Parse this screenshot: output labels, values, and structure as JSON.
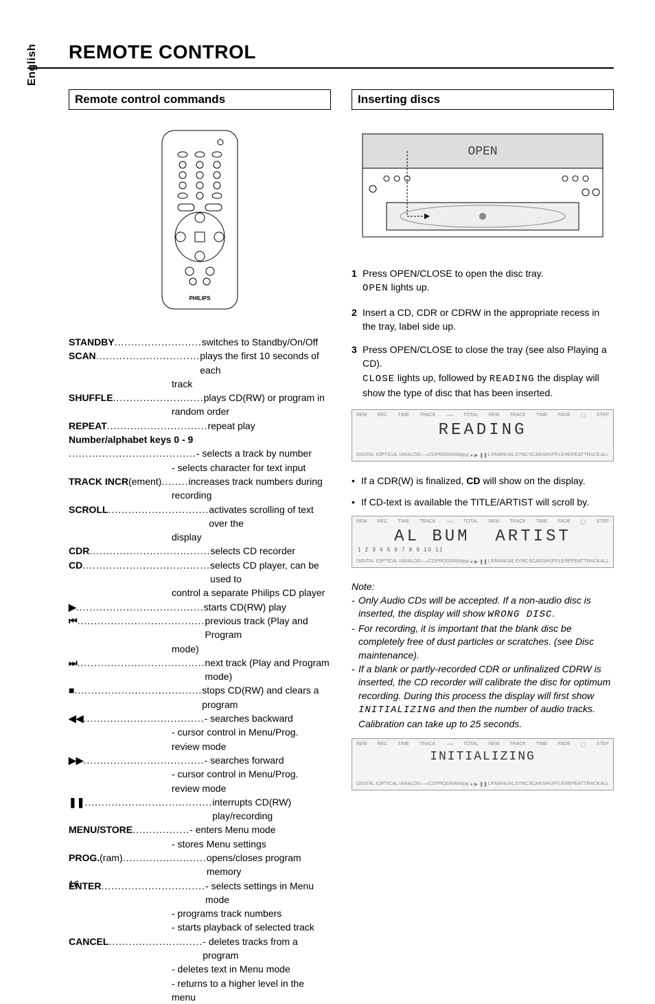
{
  "title": "REMOTE CONTROL",
  "language_tab": "English",
  "page_number": "16",
  "left": {
    "section": "Remote control commands",
    "commands": [
      {
        "term": "STANDBY",
        "dots": "..........................",
        "desc": "switches to Standby/On/Off"
      },
      {
        "term": "SCAN",
        "dots": "...............................",
        "desc": "plays the first 10 seconds of each"
      },
      {
        "cont": "track"
      },
      {
        "term": "SHUFFLE",
        "dots": "...........................",
        "desc": "plays CD(RW) or program in"
      },
      {
        "cont": "random order"
      },
      {
        "term": "REPEAT",
        "dots": "..............................",
        "desc": "repeat play"
      },
      {
        "term": "Number/alphabet keys 0 - 9"
      },
      {
        "dots": "......................................",
        "desc": "- selects a track by number"
      },
      {
        "cont": "- selects character for text input"
      },
      {
        "term": "TRACK INCR",
        "plain": "(ement)",
        "dots": " ........",
        "desc": "increases track numbers during"
      },
      {
        "cont": "recording"
      },
      {
        "term": "SCROLL",
        "dots": "..............................",
        "desc": "activates scrolling of text over the"
      },
      {
        "cont": "display"
      },
      {
        "term": "CDR",
        "dots": "....................................",
        "desc": "selects CD recorder"
      },
      {
        "term": "CD",
        "dots": "......................................",
        "desc": "selects CD player, can be used to"
      },
      {
        "cont": "control a separate Philips CD player"
      },
      {
        "sym": "▶",
        "dots": "......................................",
        "desc": "starts CD(RW) play"
      },
      {
        "sym": "⏮",
        "dots": "......................................",
        "desc": "previous track (Play and Program"
      },
      {
        "cont": "mode)"
      },
      {
        "sym": "⏭",
        "dots": "......................................",
        "desc": "next track (Play and Program mode)"
      },
      {
        "sym": "■",
        "dots": "......................................",
        "desc": "stops CD(RW) and clears a program"
      },
      {
        "sym": "◀◀",
        "dots": "....................................",
        "desc": "- searches backward"
      },
      {
        "cont": "- cursor control in Menu/Prog."
      },
      {
        "cont": "  review mode"
      },
      {
        "sym": "▶▶",
        "dots": "....................................",
        "desc": "- searches forward"
      },
      {
        "cont": "- cursor control in Menu/Prog."
      },
      {
        "cont": "  review mode"
      },
      {
        "sym": "❚❚",
        "dots": "......................................",
        "desc": "interrupts CD(RW) play/recording"
      },
      {
        "term": "MENU/STORE",
        "dots": " .................",
        "desc": "- enters Menu mode"
      },
      {
        "cont": "- stores Menu settings"
      },
      {
        "term": "PROG.",
        "plain": "(ram)",
        "dots": " .........................",
        "desc": "opens/closes program memory"
      },
      {
        "term": "ENTER",
        "dots": "...............................",
        "desc": "- selects settings in Menu mode"
      },
      {
        "cont": "- programs track numbers"
      },
      {
        "cont": "- starts playback of selected track"
      },
      {
        "term": "CANCEL",
        "dots": " ............................",
        "desc": "- deletes tracks from a program"
      },
      {
        "cont": "- deletes text in Menu mode"
      },
      {
        "cont": "- returns to a higher level in the"
      },
      {
        "cont": "  menu"
      }
    ]
  },
  "right": {
    "section": "Inserting discs",
    "steps": [
      {
        "n": "1",
        "lines": [
          "Press OPEN/CLOSE to open the disc tray."
        ],
        "lcd_line": "OPEN lights up."
      },
      {
        "n": "2",
        "lines": [
          "Insert a CD, CDR or CDRW in the appropriate recess in the tray, label side up."
        ]
      },
      {
        "n": "3",
        "lines": [
          "Press OPEN/CLOSE to close the tray (see also Playing a CD)."
        ],
        "lcd_follow": "CLOSE lights up, followed by READING the display will show the type of disc that has been inserted."
      }
    ],
    "lcd1_main": "READING",
    "bullets": [
      {
        "pre": "If a CDR(W) is finalized, ",
        "bold": "CD",
        "post": " will show on the display."
      },
      {
        "pre": "If CD-text is available the TITLE/ARTIST will scroll by."
      }
    ],
    "lcd2_left": "AL BUM",
    "lcd2_right": "ARTIST",
    "lcd2_tracks": "1 2 3 4 5 6 7 8 9 10 11",
    "note_title": "Note:",
    "notes": [
      "Only Audio CDs will be accepted. If a non-audio disc is inserted, the display will show WRONG DISC.",
      "For recording, it is important that the blank disc be completely free of dust particles or scratches. (see Disc maintenance).",
      "If a blank or partly-recorded CDR or unfinalized CDRW is inserted, the CD recorder will calibrate the disc for optimum recording. During this process the display will first show INITIALIZING and then the number of audio tracks. Calibration can take up to 25 seconds."
    ],
    "lcd3_main": "INITIALIZING",
    "lcd_top_labels": [
      "REM",
      "REC",
      "TIME",
      "TRACK",
      "⟶",
      "TOTAL",
      "REM",
      "TRACK",
      "TIME",
      "FADE",
      "◯",
      "STEP"
    ],
    "lcd_bot_labels": [
      "DIGITAL I",
      "OPTICAL I",
      "ANALOG",
      "⟶",
      "CD",
      "PROGRAM",
      "RW ● ▶ ❚❚",
      "L",
      "R",
      "MANUAL",
      "SYNC",
      "SCAN",
      "SHUFFLE",
      "REPEAT",
      "TRACK",
      "ALL"
    ]
  }
}
